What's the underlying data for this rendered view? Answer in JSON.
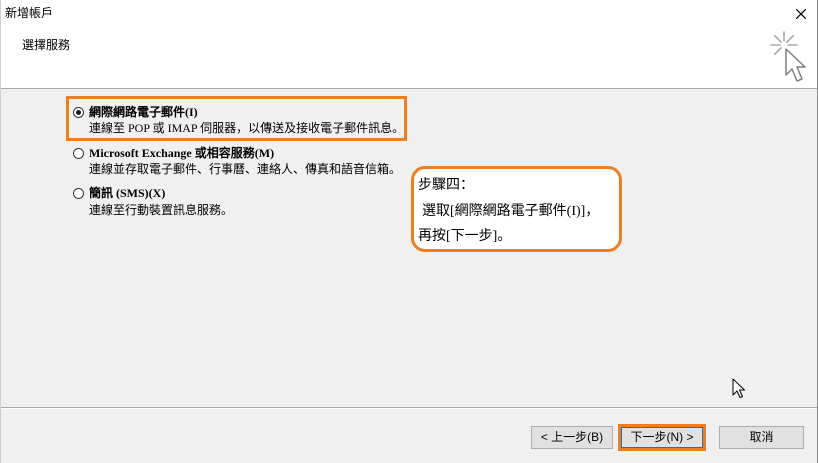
{
  "window": {
    "title": "新增帳戶"
  },
  "header": {
    "title": "選擇服務"
  },
  "options": [
    {
      "label": "網際網路電子郵件(I)",
      "description": "連線至 POP 或 IMAP 伺服器，以傳送及接收電子郵件訊息。",
      "selected": true
    },
    {
      "label": "Microsoft Exchange 或相容服務(M)",
      "description": "連線並存取電子郵件、行事曆、連絡人、傳真和語音信箱。",
      "selected": false
    },
    {
      "label": "簡訊 (SMS)(X)",
      "description": "連線至行動裝置訊息服務。",
      "selected": false
    }
  ],
  "callout": {
    "heading": "步驟四：",
    "line1": "選取[網際網路電子郵件(I)]，",
    "line2": "再按[下一步]。"
  },
  "buttons": {
    "back": "< 上一步(B)",
    "next": "下一步(N) >",
    "cancel": "取消"
  },
  "icons": {
    "close": "close-icon",
    "header": "wizard-cursor-icon",
    "pointer": "mouse-pointer-icon"
  },
  "colors": {
    "highlight": "#f07d1e",
    "panel_background": "#f0f0f0",
    "header_background": "#ffffff",
    "button_background": "#e1e1e1"
  }
}
